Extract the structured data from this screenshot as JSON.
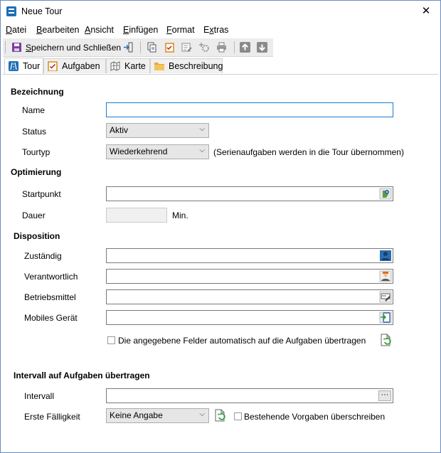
{
  "window": {
    "title": "Neue Tour",
    "close_glyph": "✕"
  },
  "menu": [
    {
      "label_pre": "",
      "label_ul": "D",
      "label_post": "atei"
    },
    {
      "label_pre": "",
      "label_ul": "B",
      "label_post": "earbeiten"
    },
    {
      "label_pre": "",
      "label_ul": "A",
      "label_post": "nsicht"
    },
    {
      "label_pre": "",
      "label_ul": "E",
      "label_post": "infügen"
    },
    {
      "label_pre": "",
      "label_ul": "F",
      "label_post": "ormat"
    },
    {
      "label_pre": "E",
      "label_ul": "x",
      "label_post": "tras"
    }
  ],
  "toolbar": {
    "save_pre": "",
    "save_ul": "S",
    "save_post": "peichern und Schließen",
    "icons": [
      "save-icon",
      "exit-icon",
      "copy-doc-icon",
      "checklist-icon",
      "edit-list-icon",
      "gear-add-icon",
      "print-icon",
      "arrow-up-icon",
      "arrow-down-icon"
    ]
  },
  "tabs": [
    {
      "label": "Tour",
      "icon": "road-icon",
      "active": true
    },
    {
      "label": "Aufgaben",
      "icon": "clipboard-check-icon",
      "active": false
    },
    {
      "label": "Karte",
      "icon": "map-icon",
      "active": false
    },
    {
      "label": "Beschreibung",
      "icon": "folder-icon",
      "active": false
    }
  ],
  "sections": {
    "bezeichnung": "Bezeichnung",
    "optimierung": "Optimierung",
    "disposition": "Disposition",
    "intervall": "Intervall auf Aufgaben übertragen"
  },
  "fields": {
    "name": {
      "label": "Name",
      "value": ""
    },
    "status": {
      "label": "Status",
      "value": "Aktiv"
    },
    "tourtyp": {
      "label": "Tourtyp",
      "value": "Wiederkehrend",
      "note": "(Serienaufgaben werden in die Tour übernommen)"
    },
    "startpunkt": {
      "label": "Startpunkt",
      "value": ""
    },
    "dauer": {
      "label": "Dauer",
      "value": "",
      "unit": "Min."
    },
    "zustaendig": {
      "label": "Zuständig",
      "value": ""
    },
    "verantwortlich": {
      "label": "Verantwortlich",
      "value": ""
    },
    "betriebsmittel": {
      "label": "Betriebsmittel",
      "value": ""
    },
    "mobiles_geraet": {
      "label": "Mobiles Gerät",
      "value": ""
    },
    "auto_transfer": {
      "label": "Die angegebene Felder automatisch auf die Aufgaben übertragen",
      "checked": false
    },
    "intervall": {
      "label": "Intervall",
      "value": "",
      "button": "···"
    },
    "erste_faelligkeit": {
      "label": "Erste Fälligkeit",
      "value": "Keine Angabe"
    },
    "overwrite": {
      "label": "Bestehende Vorgaben überschreiben",
      "checked": false
    }
  },
  "colors": {
    "accent": "#1a7bd3",
    "window_border": "#6b8cbf",
    "save_purple": "#7b3fa0",
    "up_down_gray": "#8a8a8a"
  }
}
